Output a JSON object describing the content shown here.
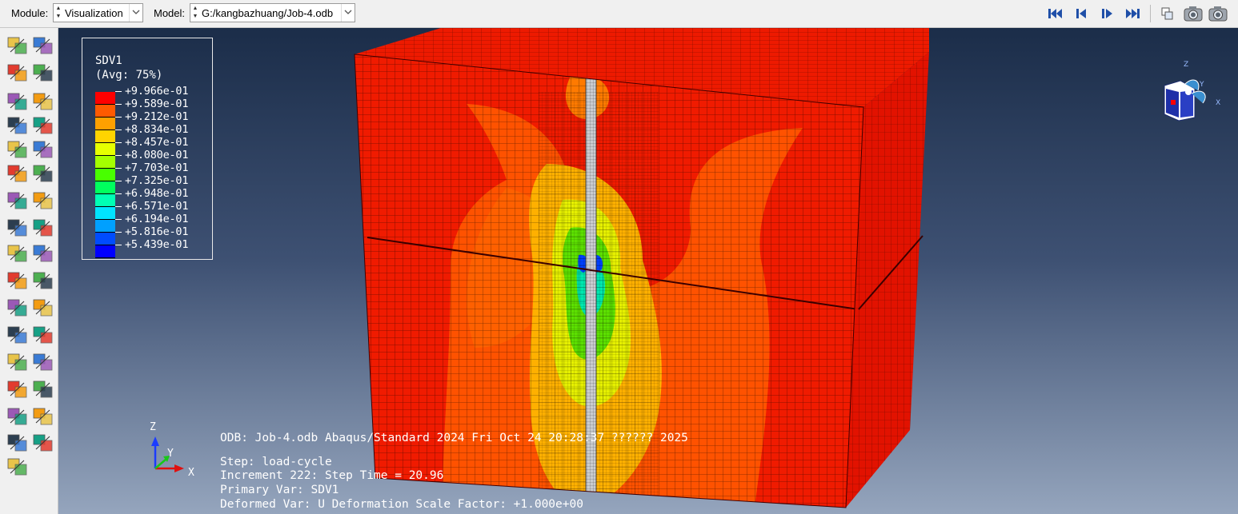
{
  "toolbar": {
    "module_label": "Module:",
    "module_value": "Visualization",
    "model_label": "Model:",
    "model_value": "G:/kangbazhuang/Job-4.odb",
    "nav_icons": [
      "first-frame-icon",
      "previous-frame-icon",
      "next-frame-icon",
      "last-frame-icon"
    ],
    "view_icons": [
      "overlay-plot-icon",
      "camera-icon",
      "camera-options-icon"
    ]
  },
  "sidebar": {
    "tools": [
      "plot-undeformed-icon",
      "plot-deformed-icon",
      "plot-contours-undeformed-icon",
      "plot-contours-deformed-icon",
      "plot-contours-both-icon",
      "contour-options-icon",
      "plot-symbols-icon",
      "symbol-options-icon",
      "plot-material-orientations-icon",
      "orientation-options-icon",
      "plot-allowable-icon",
      "allowable-options-icon",
      "animate-scale-factor-icon",
      "animate-time-history-icon",
      "animate-harmonic-icon",
      "animation-options-icon",
      "view-cut-icon",
      "view-cut-manager-icon",
      "xy-data-icon",
      "xy-data-manager-icon",
      "create-path-icon",
      "plot-xy-icon",
      "display-group-icon",
      "display-group-manager-icon",
      "probe-values-icon",
      "report-icon",
      "free-body-icon",
      "free-body-manager-icon",
      "stream-icon",
      "stream-manager-icon",
      "query-icon",
      "result-options-icon",
      "query-information-icon"
    ]
  },
  "legend": {
    "title": "SDV1",
    "subtitle": "(Avg: 75%)",
    "labels": [
      "+9.966e-01",
      "+9.589e-01",
      "+9.212e-01",
      "+8.834e-01",
      "+8.457e-01",
      "+8.080e-01",
      "+7.703e-01",
      "+7.325e-01",
      "+6.948e-01",
      "+6.571e-01",
      "+6.194e-01",
      "+5.816e-01",
      "+5.439e-01"
    ],
    "colors": [
      "#ff0000",
      "#ff5a00",
      "#ffa000",
      "#ffd400",
      "#e6ff00",
      "#a4ff00",
      "#48ff00",
      "#00ff5e",
      "#00ffb4",
      "#00e4ff",
      "#00a0ff",
      "#004cff",
      "#0000ff"
    ]
  },
  "triad": {
    "z": "Z",
    "y": "Y",
    "x": "X"
  },
  "info": {
    "odb_line": "ODB: Job-4.odb    Abaqus/Standard 2024    Fri Oct 24 20:28:37 ?????? 2025",
    "step_line": "Step: load-cycle",
    "increment_line": "Increment    222: Step Time =    20.96",
    "primary_line": "Primary Var: SDV1",
    "deformed_line": "Deformed Var: U   Deformation Scale Factor: +1.000e+00"
  }
}
